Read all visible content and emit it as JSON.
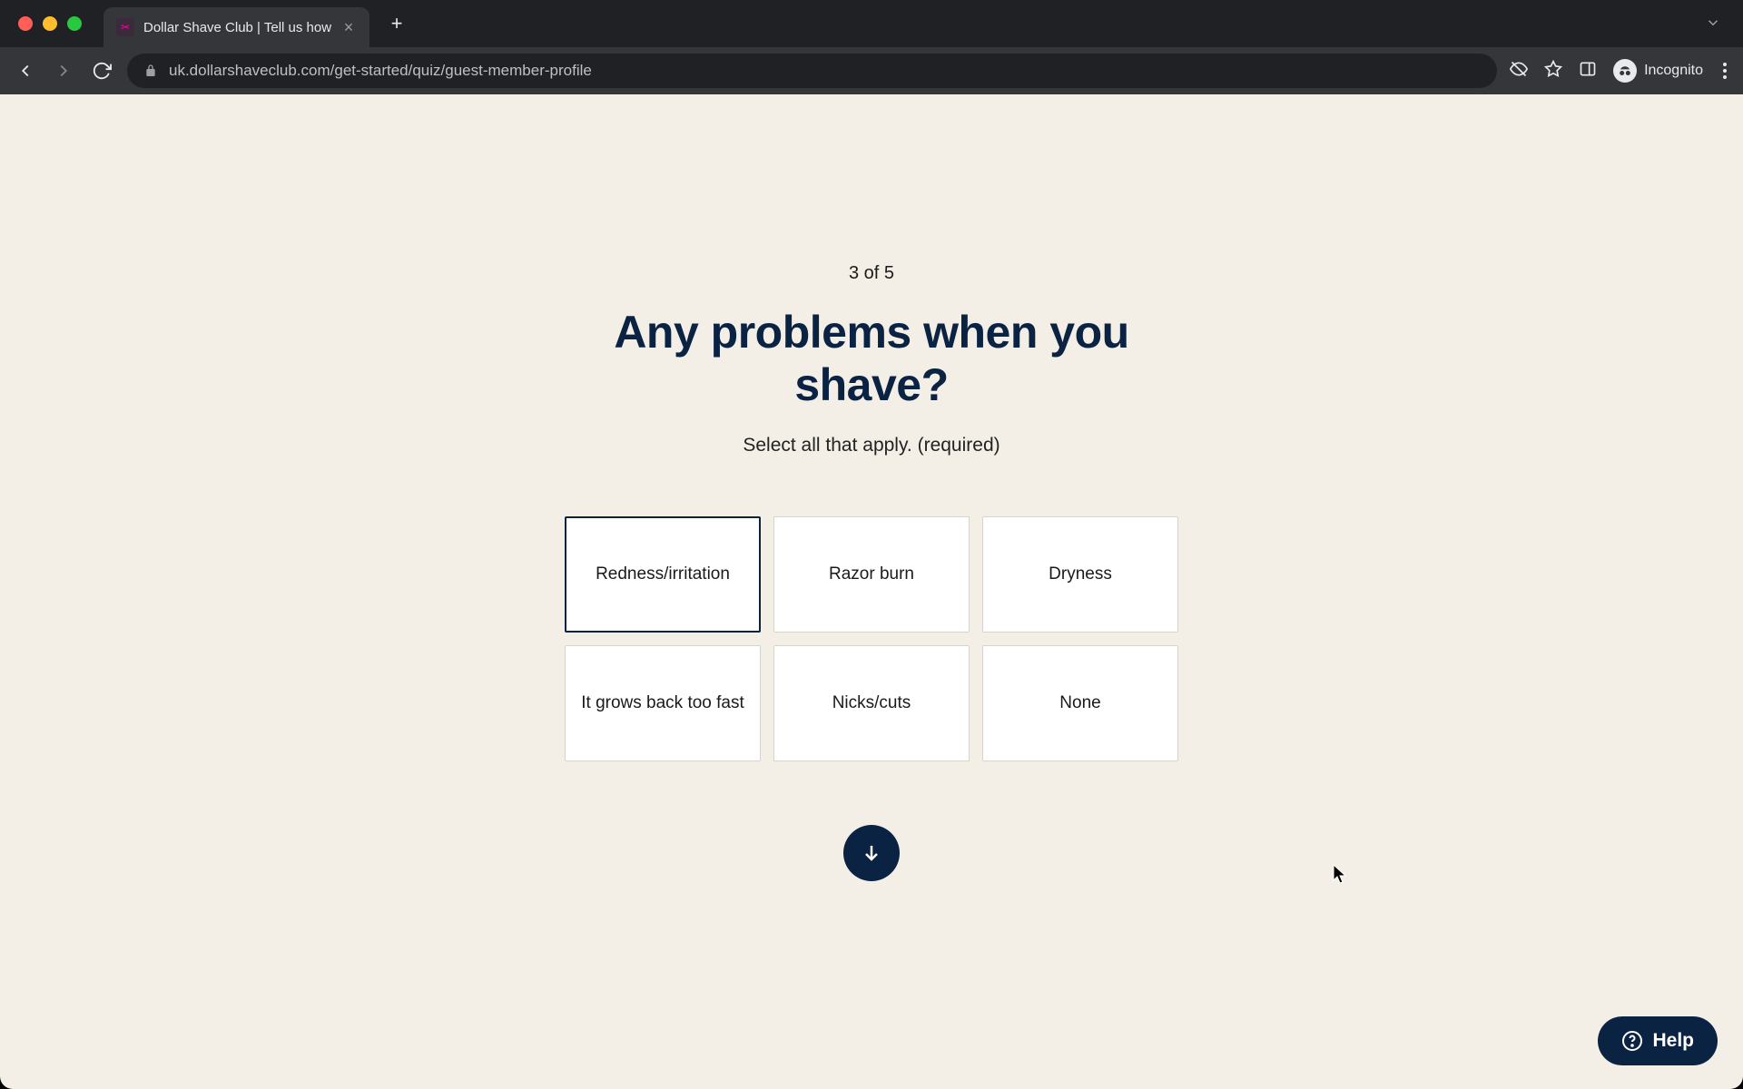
{
  "browser": {
    "tab_title": "Dollar Shave Club | Tell us how",
    "url_display": "uk.dollarshaveclub.com/get-started/quiz/guest-member-profile",
    "incognito_label": "Incognito"
  },
  "quiz": {
    "progress": "3 of 5",
    "question": "Any problems when you shave?",
    "instruction": "Select all that apply. (required)",
    "options": [
      {
        "label": "Redness/irritation",
        "selected": true
      },
      {
        "label": "Razor burn",
        "selected": false
      },
      {
        "label": "Dryness",
        "selected": false
      },
      {
        "label": "It grows back too fast",
        "selected": false
      },
      {
        "label": "Nicks/cuts",
        "selected": false
      },
      {
        "label": "None",
        "selected": false
      }
    ]
  },
  "help": {
    "label": "Help"
  }
}
